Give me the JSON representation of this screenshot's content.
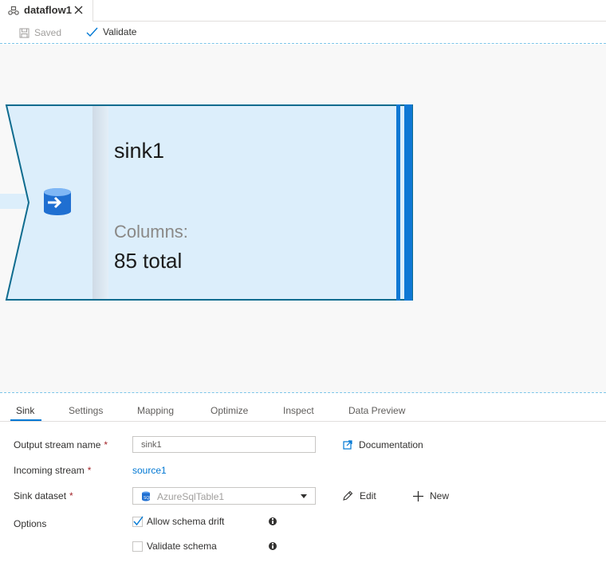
{
  "tab": {
    "title": "dataflow1"
  },
  "toolbar": {
    "saved_label": "Saved",
    "validate_label": "Validate"
  },
  "node": {
    "name": "sink1",
    "columns_label": "Columns:",
    "columns_value": "85 total"
  },
  "panel": {
    "tabs": [
      "Sink",
      "Settings",
      "Mapping",
      "Optimize",
      "Inspect",
      "Data Preview"
    ],
    "active_tab": "Sink"
  },
  "form": {
    "output_stream_label": "Output stream name",
    "output_stream_value": "sink1",
    "documentation_label": "Documentation",
    "incoming_stream_label": "Incoming stream",
    "incoming_stream_value": "source1",
    "sink_dataset_label": "Sink dataset",
    "sink_dataset_value": "AzureSqlTable1",
    "edit_label": "Edit",
    "new_label": "New",
    "options_label": "Options",
    "allow_schema_drift_label": "Allow schema drift",
    "allow_schema_drift_checked": true,
    "validate_schema_label": "Validate schema",
    "validate_schema_checked": false,
    "required_marker": "*"
  },
  "colors": {
    "accent": "#0078d4",
    "node_fill": "#dceefb",
    "node_border": "#0f6c8f",
    "required": "#a4262c"
  },
  "icons": [
    "dataflow-icon",
    "close-icon",
    "save-icon",
    "checkmark-icon",
    "sink-database-icon",
    "external-link-icon",
    "pencil-icon",
    "plus-icon",
    "info-icon",
    "chevron-down-icon",
    "sql-table-icon"
  ]
}
